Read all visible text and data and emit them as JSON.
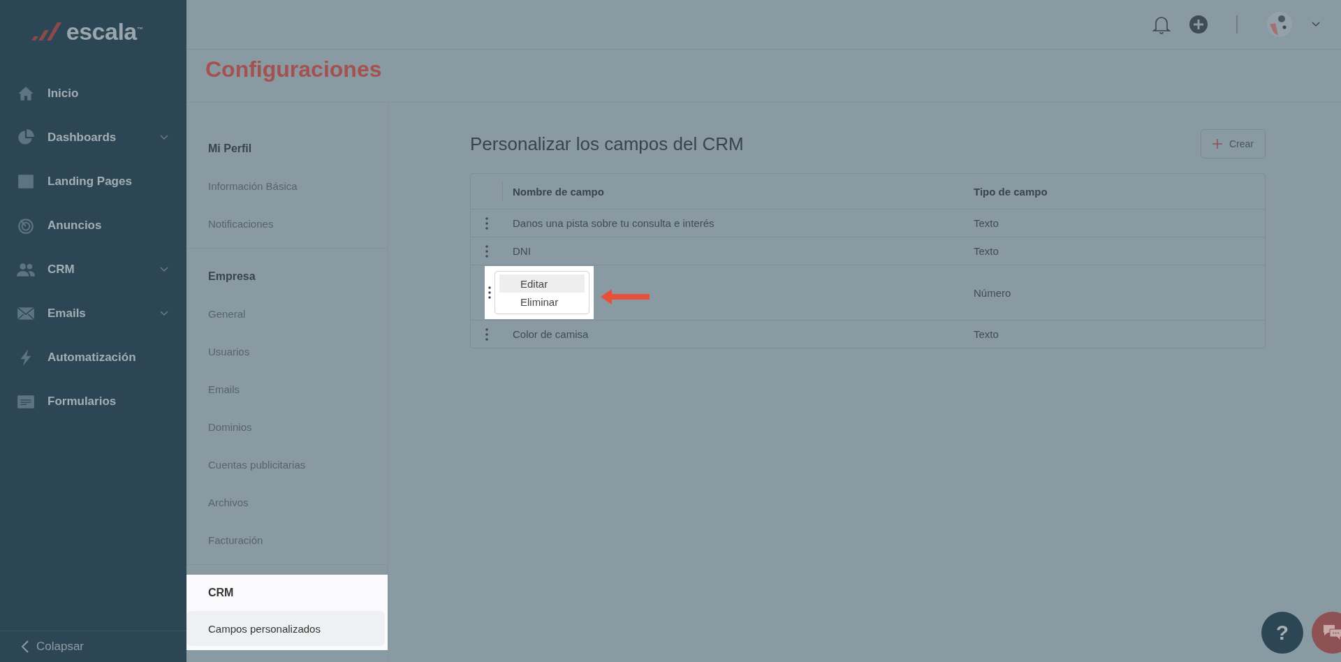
{
  "sidebar": {
    "logo": "escala",
    "logo_mark": "™",
    "items": [
      {
        "label": "Inicio",
        "expandable": false
      },
      {
        "label": "Dashboards",
        "expandable": true
      },
      {
        "label": "Landing Pages",
        "expandable": false
      },
      {
        "label": "Anuncios",
        "expandable": false
      },
      {
        "label": "CRM",
        "expandable": true
      },
      {
        "label": "Emails",
        "expandable": true
      },
      {
        "label": "Automatización",
        "expandable": false
      },
      {
        "label": "Formularios",
        "expandable": false
      }
    ],
    "collapse": "Colapsar"
  },
  "page_title": "Configuraciones",
  "settings_nav": [
    {
      "heading": "Mi Perfil",
      "highlighted": false,
      "items": [
        {
          "label": "Información Básica",
          "selected": false
        },
        {
          "label": "Notificaciones",
          "selected": false
        }
      ]
    },
    {
      "heading": "Empresa",
      "highlighted": false,
      "items": [
        {
          "label": "General",
          "selected": false
        },
        {
          "label": "Usuarios",
          "selected": false
        },
        {
          "label": "Emails",
          "selected": false
        },
        {
          "label": "Dominios",
          "selected": false
        },
        {
          "label": "Cuentas publicitarias",
          "selected": false
        },
        {
          "label": "Archivos",
          "selected": false
        },
        {
          "label": "Facturación",
          "selected": false
        }
      ]
    },
    {
      "heading": "CRM",
      "highlighted": true,
      "items": [
        {
          "label": "Campos personalizados",
          "selected": true
        }
      ]
    }
  ],
  "content": {
    "heading": "Personalizar los campos del CRM",
    "create_button": "Crear",
    "table": {
      "columns": [
        "Nombre de campo",
        "Tipo de campo"
      ],
      "rows": [
        {
          "name": "Danos una pista sobre tu consulta e interés",
          "type": "Texto",
          "menu_open": false
        },
        {
          "name": "DNI",
          "type": "Texto",
          "menu_open": false
        },
        {
          "type": "Número",
          "menu_open": true
        },
        {
          "name": "Color de camisa",
          "type": "Texto",
          "menu_open": false
        }
      ]
    },
    "row_menu": [
      {
        "label": "Editar",
        "selected": true
      },
      {
        "label": "Eliminar",
        "selected": false
      }
    ]
  },
  "help_button": "?"
}
